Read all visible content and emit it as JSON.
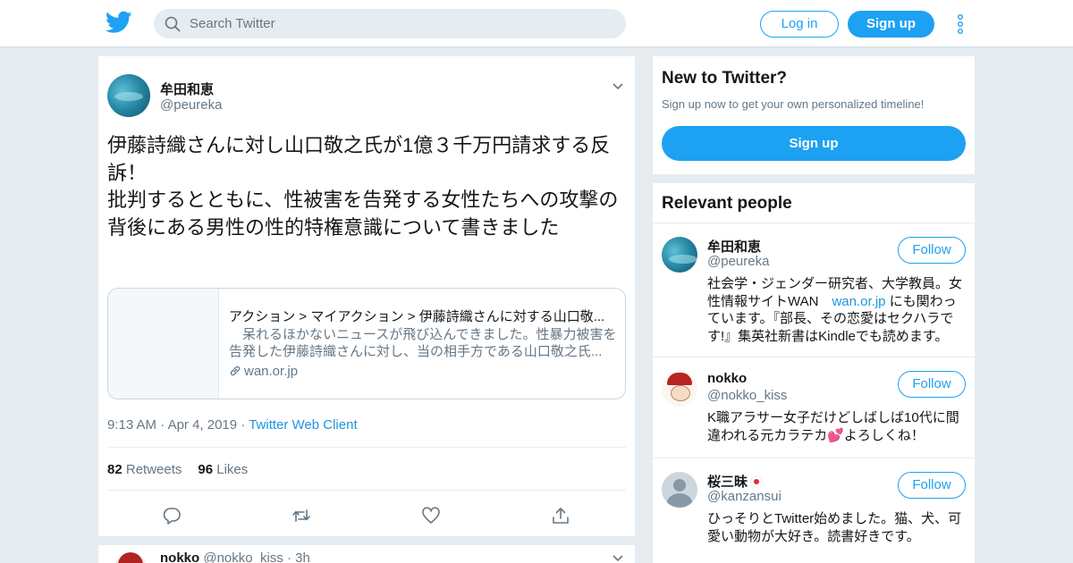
{
  "header": {
    "search_placeholder": "Search Twitter",
    "login_label": "Log in",
    "signup_label": "Sign up"
  },
  "tweet": {
    "author_name": "牟田和恵",
    "author_handle": "@peureka",
    "text": "伊藤詩織さんに対し山口敬之氏が1億３千万円請求する反訴！\n批判するとともに、性被害を告発する女性たちへの攻撃の背後にある男性の性的特権意識について書きました",
    "card": {
      "title": "アクション > マイアクション > 伊藤詩織さんに対する山口敬...",
      "description": "　呆れるほかないニュースが飛び込んできました。性暴力被害を告発した伊藤詩織さんに対し、当の相手方である山口敬之氏...",
      "domain": "wan.or.jp"
    },
    "time": "9:13 AM",
    "date": "Apr 4, 2019",
    "client": "Twitter Web Client",
    "retweets_count": "82",
    "retweets_label": "Retweets",
    "likes_count": "96",
    "likes_label": "Likes"
  },
  "reply_preview": {
    "name": "nokko",
    "handle": "@nokko_kiss",
    "age": "3h"
  },
  "new_to_twitter": {
    "title": "New to Twitter?",
    "subtitle": "Sign up now to get your own personalized timeline!",
    "button": "Sign up"
  },
  "relevant_people": {
    "title": "Relevant people",
    "follow_label": "Follow",
    "people": [
      {
        "name": "牟田和恵",
        "handle": "@peureka",
        "bio_before": "社会学・ジェンダー研究者、大学教員。女性情報サイトWAN　",
        "bio_link": "wan.or.jp",
        "bio_after": " にも関わっています。『部長、その恋愛はセクハラです!』集英社新書はKindleでも読めます。"
      },
      {
        "name": "nokko",
        "handle": "@nokko_kiss",
        "bio": "K職アラサー女子だけどしばしば10代に間違われる元カラテカ💕よろしくね！"
      },
      {
        "name": "桜三昧",
        "handle": "@kanzansui",
        "bio": "ひっそりとTwitter始めました。猫、犬、可愛い動物が大好き。読書好きです。"
      }
    ]
  },
  "colors": {
    "brand": "#1da1f2",
    "link": "#1b95e0",
    "muted": "#657786",
    "background": "#e6ecf0"
  }
}
